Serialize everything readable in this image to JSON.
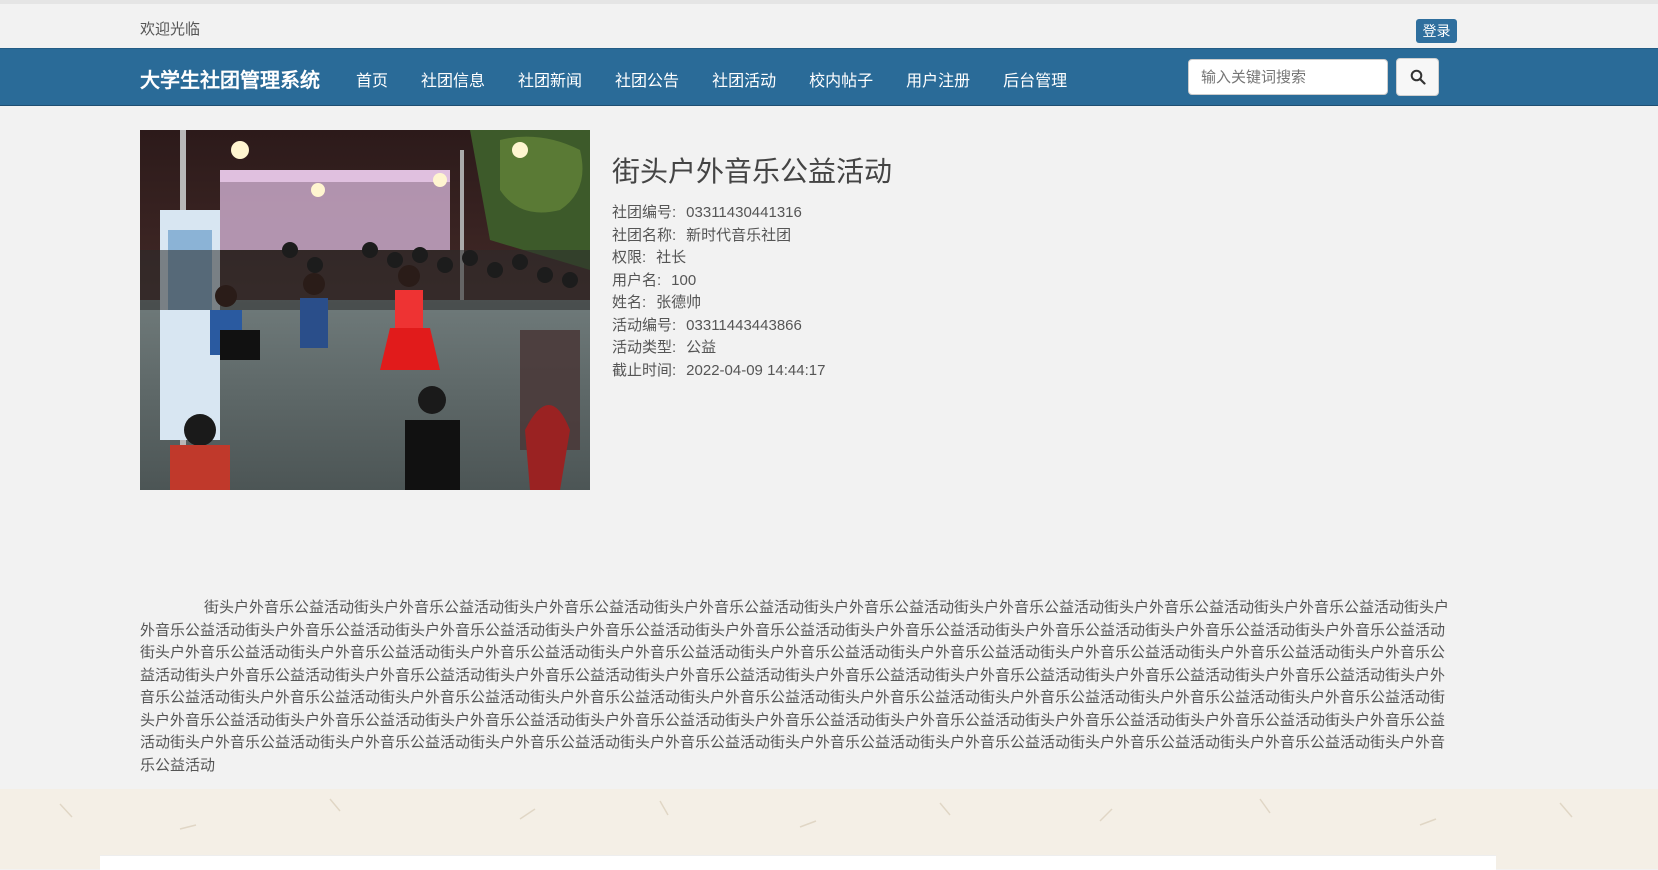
{
  "topbar": {
    "welcome": "欢迎光临",
    "login_label": "登录"
  },
  "navbar": {
    "brand": "大学生社团管理系统",
    "items": [
      {
        "label": "首页"
      },
      {
        "label": "社团信息"
      },
      {
        "label": "社团新闻"
      },
      {
        "label": "社团公告"
      },
      {
        "label": "社团活动"
      },
      {
        "label": "校内帖子"
      },
      {
        "label": "用户注册"
      },
      {
        "label": "后台管理"
      }
    ],
    "search_placeholder": "输入关键词搜索",
    "search_icon": "search-icon"
  },
  "activity": {
    "title": "街头户外音乐公益活动",
    "image_icon": "street-music-photo",
    "rows": [
      {
        "key": "社团编号:",
        "value": "03311430441316"
      },
      {
        "key": "社团名称:",
        "value": "新时代音乐社团"
      },
      {
        "key": "权限:",
        "value": "社长"
      },
      {
        "key": "用户名:",
        "value": "100"
      },
      {
        "key": "姓名:",
        "value": "张德帅"
      },
      {
        "key": "活动编号:",
        "value": "03311443443866"
      },
      {
        "key": "活动类型:",
        "value": "公益"
      },
      {
        "key": "截止时间:",
        "value": "2022-04-09 14:44:17"
      }
    ],
    "description": "街头户外音乐公益活动街头户外音乐公益活动街头户外音乐公益活动街头户外音乐公益活动街头户外音乐公益活动街头户外音乐公益活动街头户外音乐公益活动街头户外音乐公益活动街头户外音乐公益活动街头户外音乐公益活动街头户外音乐公益活动街头户外音乐公益活动街头户外音乐公益活动街头户外音乐公益活动街头户外音乐公益活动街头户外音乐公益活动街头户外音乐公益活动街头户外音乐公益活动街头户外音乐公益活动街头户外音乐公益活动街头户外音乐公益活动街头户外音乐公益活动街头户外音乐公益活动街头户外音乐公益活动街头户外音乐公益活动街头户外音乐公益活动街头户外音乐公益活动街头户外音乐公益活动街头户外音乐公益活动街头户外音乐公益活动街头户外音乐公益活动街头户外音乐公益活动街头户外音乐公益活动街头户外音乐公益活动街头户外音乐公益活动街头户外音乐公益活动街头户外音乐公益活动街头户外音乐公益活动街头户外音乐公益活动街头户外音乐公益活动街头户外音乐公益活动街头户外音乐公益活动街头户外音乐公益活动街头户外音乐公益活动街头户外音乐公益活动街头户外音乐公益活动街头户外音乐公益活动街头户外音乐公益活动街头户外音乐公益活动街头户外音乐公益活动街头户外音乐公益活动街头户外音乐公益活动街头户外音乐公益活动街头户外音乐公益活动街头户外音乐公益活动街头户外音乐公益活动街头户外音乐公益活动街头户外音乐公益活动街头户外音乐公益活动街头户外音乐公益活动街头户外音乐公益活动"
  },
  "colors": {
    "nav_bg": "#2a6b98",
    "login_bg": "#2f6f9e",
    "page_bg": "#f2f2f2"
  }
}
